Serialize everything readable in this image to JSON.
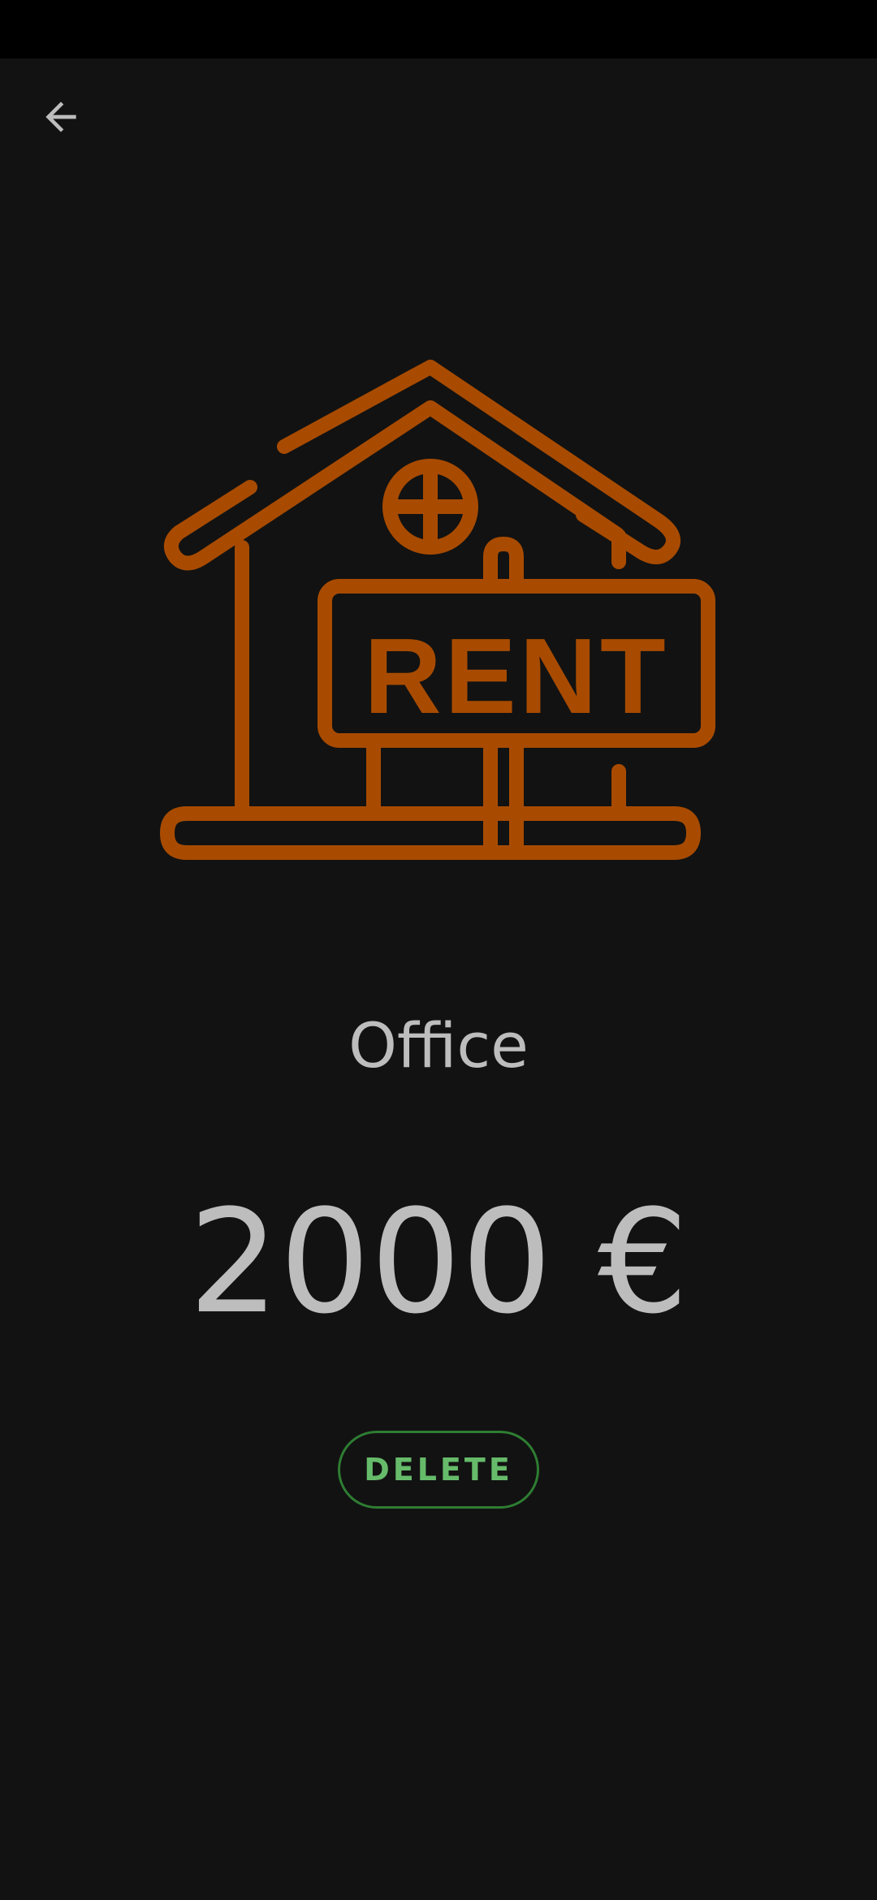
{
  "header": {
    "back_icon": "arrow-left-icon"
  },
  "illustration": {
    "icon": "house-rent-sign-icon",
    "sign_text": "RENT",
    "color": "#a84b00"
  },
  "main": {
    "title": "Office",
    "amount": "2000 €",
    "delete_label": "DELETE"
  },
  "colors": {
    "background": "#121212",
    "status_bar": "#000000",
    "text": "#bdbdbd",
    "button_border": "#2e7d32",
    "button_text": "#66bb6a"
  }
}
